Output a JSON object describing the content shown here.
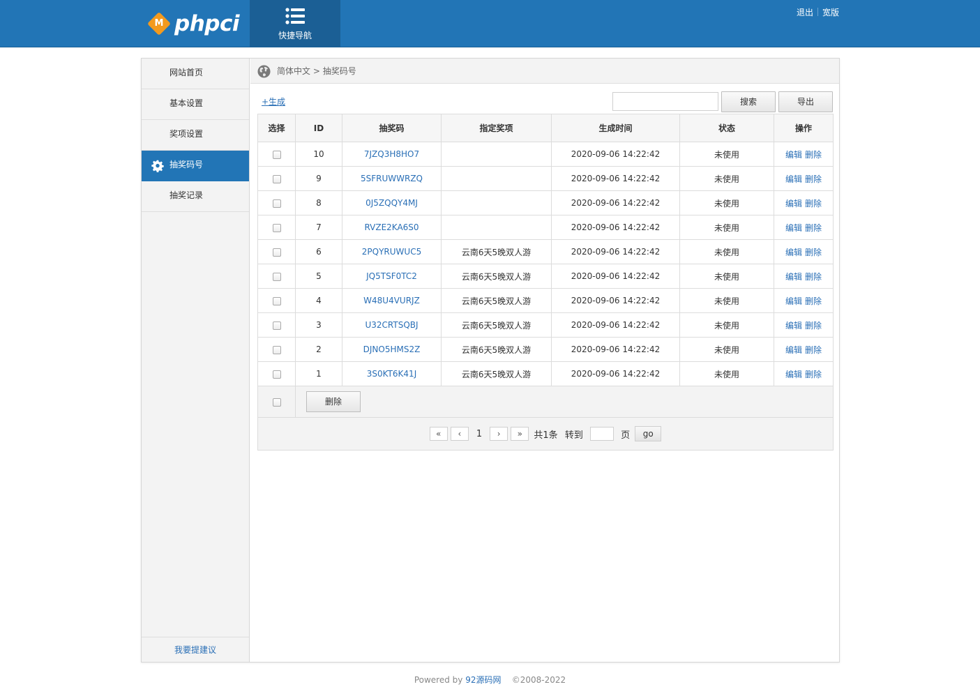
{
  "header": {
    "logo_text": "phpci",
    "logo_badge": "M",
    "quicknav_label": "快捷导航",
    "logout_label": "退出",
    "wide_label": "宽版",
    "brand_color": "#2275b6"
  },
  "sidebar": {
    "items": [
      {
        "label": "网站首页",
        "active": false
      },
      {
        "label": "基本设置",
        "active": false
      },
      {
        "label": "奖项设置",
        "active": false
      },
      {
        "label": "抽奖码号",
        "active": true,
        "icon": "gear-icon"
      },
      {
        "label": "抽奖记录",
        "active": false
      }
    ],
    "feedback_label": "我要提建议"
  },
  "breadcrumb": {
    "icon": "globe-icon",
    "root": "简体中文",
    "separator": ">",
    "current": "抽奖码号"
  },
  "toolbar": {
    "generate_label": "+生成",
    "search_value": "",
    "search_label": "搜索",
    "export_label": "导出"
  },
  "table": {
    "columns": [
      "选择",
      "ID",
      "抽奖码",
      "指定奖项",
      "生成时间",
      "状态",
      "操作"
    ],
    "rows": [
      {
        "id": "10",
        "code": "7JZQ3H8HO7",
        "prize": "",
        "time": "2020-09-06 14:22:42",
        "status": "未使用"
      },
      {
        "id": "9",
        "code": "5SFRUWWRZQ",
        "prize": "",
        "time": "2020-09-06 14:22:42",
        "status": "未使用"
      },
      {
        "id": "8",
        "code": "0J5ZQQY4MJ",
        "prize": "",
        "time": "2020-09-06 14:22:42",
        "status": "未使用"
      },
      {
        "id": "7",
        "code": "RVZE2KA6S0",
        "prize": "",
        "time": "2020-09-06 14:22:42",
        "status": "未使用"
      },
      {
        "id": "6",
        "code": "2PQYRUWUC5",
        "prize": "云南6天5晚双人游",
        "time": "2020-09-06 14:22:42",
        "status": "未使用"
      },
      {
        "id": "5",
        "code": "JQ5TSF0TC2",
        "prize": "云南6天5晚双人游",
        "time": "2020-09-06 14:22:42",
        "status": "未使用"
      },
      {
        "id": "4",
        "code": "W48U4VURJZ",
        "prize": "云南6天5晚双人游",
        "time": "2020-09-06 14:22:42",
        "status": "未使用"
      },
      {
        "id": "3",
        "code": "U32CRTSQBJ",
        "prize": "云南6天5晚双人游",
        "time": "2020-09-06 14:22:42",
        "status": "未使用"
      },
      {
        "id": "2",
        "code": "DJNO5HMS2Z",
        "prize": "云南6天5晚双人游",
        "time": "2020-09-06 14:22:42",
        "status": "未使用"
      },
      {
        "id": "1",
        "code": "3S0KT6K41J",
        "prize": "云南6天5晚双人游",
        "time": "2020-09-06 14:22:42",
        "status": "未使用"
      }
    ],
    "edit_label": "编辑",
    "delete_label": "删除",
    "bulk_delete_label": "删除"
  },
  "pager": {
    "first": "«",
    "prev": "‹",
    "current_page": "1",
    "next": "›",
    "last": "»",
    "total_text": "共1条",
    "goto_text": "转到",
    "goto_value": "",
    "page_text": "页",
    "go_label": "go"
  },
  "footer": {
    "powered_prefix": "Powered by",
    "powered_link": "92源码网",
    "copyright": "©2008-2022"
  }
}
